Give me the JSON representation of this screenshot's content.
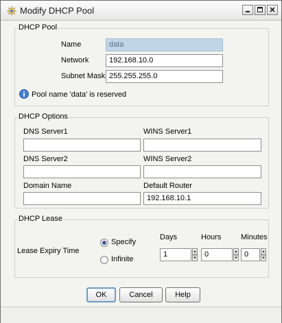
{
  "window": {
    "title": "Modify DHCP Pool"
  },
  "dhcp_pool": {
    "title": "DHCP Pool",
    "name_label": "Name",
    "name_value": "data",
    "network_label": "Network",
    "network_value": "192.168.10.0",
    "subnet_label": "Subnet Mask",
    "subnet_value": "255.255.255.0",
    "info_text": "Pool name 'data' is reserved"
  },
  "dhcp_options": {
    "title": "DHCP Options",
    "dns1_label": "DNS Server1",
    "dns1_value": "",
    "wins1_label": "WINS Server1",
    "wins1_value": "",
    "dns2_label": "DNS Server2",
    "dns2_value": "",
    "wins2_label": "WINS Server2",
    "wins2_value": "",
    "domain_label": "Domain Name",
    "domain_value": "",
    "router_label": "Default Router",
    "router_value": "192.168.10.1"
  },
  "dhcp_lease": {
    "title": "DHCP Lease",
    "expiry_label": "Lease Expiry Time",
    "specify_label": "Specify",
    "infinite_label": "Infinite",
    "selected": "Specify",
    "days_label": "Days",
    "days_value": "1",
    "hours_label": "Hours",
    "hours_value": "0",
    "minutes_label": "Minutes",
    "minutes_value": "0"
  },
  "buttons": {
    "ok": "OK",
    "cancel": "Cancel",
    "help": "Help"
  }
}
